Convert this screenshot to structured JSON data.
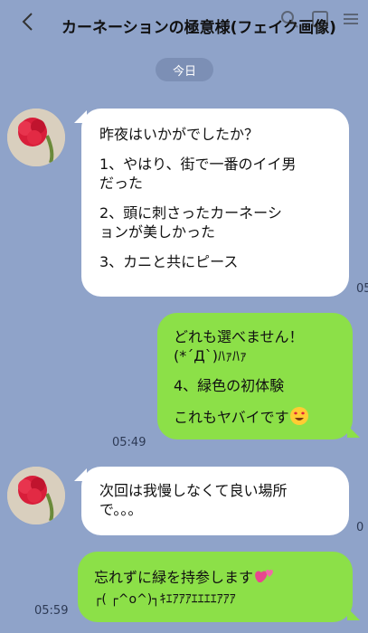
{
  "header": {
    "title": "カーネーションの極意様(フェイク画像)",
    "icons": [
      "back-icon",
      "search-icon",
      "call-icon",
      "menu-icon"
    ]
  },
  "date_label": "今日",
  "messages": [
    {
      "direction": "incoming",
      "lines": [
        "昨夜はいかがでしたか？",
        "1、やはり、街で一番のイイ男\nだった",
        "2、頭に刺さったカーネーシ\nョンが美しかった",
        "3、カニと共にピース"
      ],
      "time": "05"
    },
    {
      "direction": "outgoing",
      "lines": [
        "どれも選べません！\n(*´Д`)ﾊｧﾊｧ",
        "4、緑色の初体験",
        "これもヤバイです"
      ],
      "emoji": "heart-eyes-emoji",
      "time": "05:49"
    },
    {
      "direction": "incoming",
      "lines": [
        "次回は我慢しなくて良い場所\nで。。。"
      ],
      "time": "0"
    },
    {
      "direction": "outgoing",
      "lines": [
        "忘れずに緑を持参します",
        "┌( ┌^o^)┐ｷｴｱｱｱｴｴｴｴｱｱｱ"
      ],
      "emoji": "two-hearts-emoji",
      "time": "05:59"
    }
  ],
  "colors": {
    "background": "#8fa3c9",
    "incoming_bubble": "#ffffff",
    "outgoing_bubble": "#8ce048",
    "date_pill": "#7c8fb5"
  }
}
